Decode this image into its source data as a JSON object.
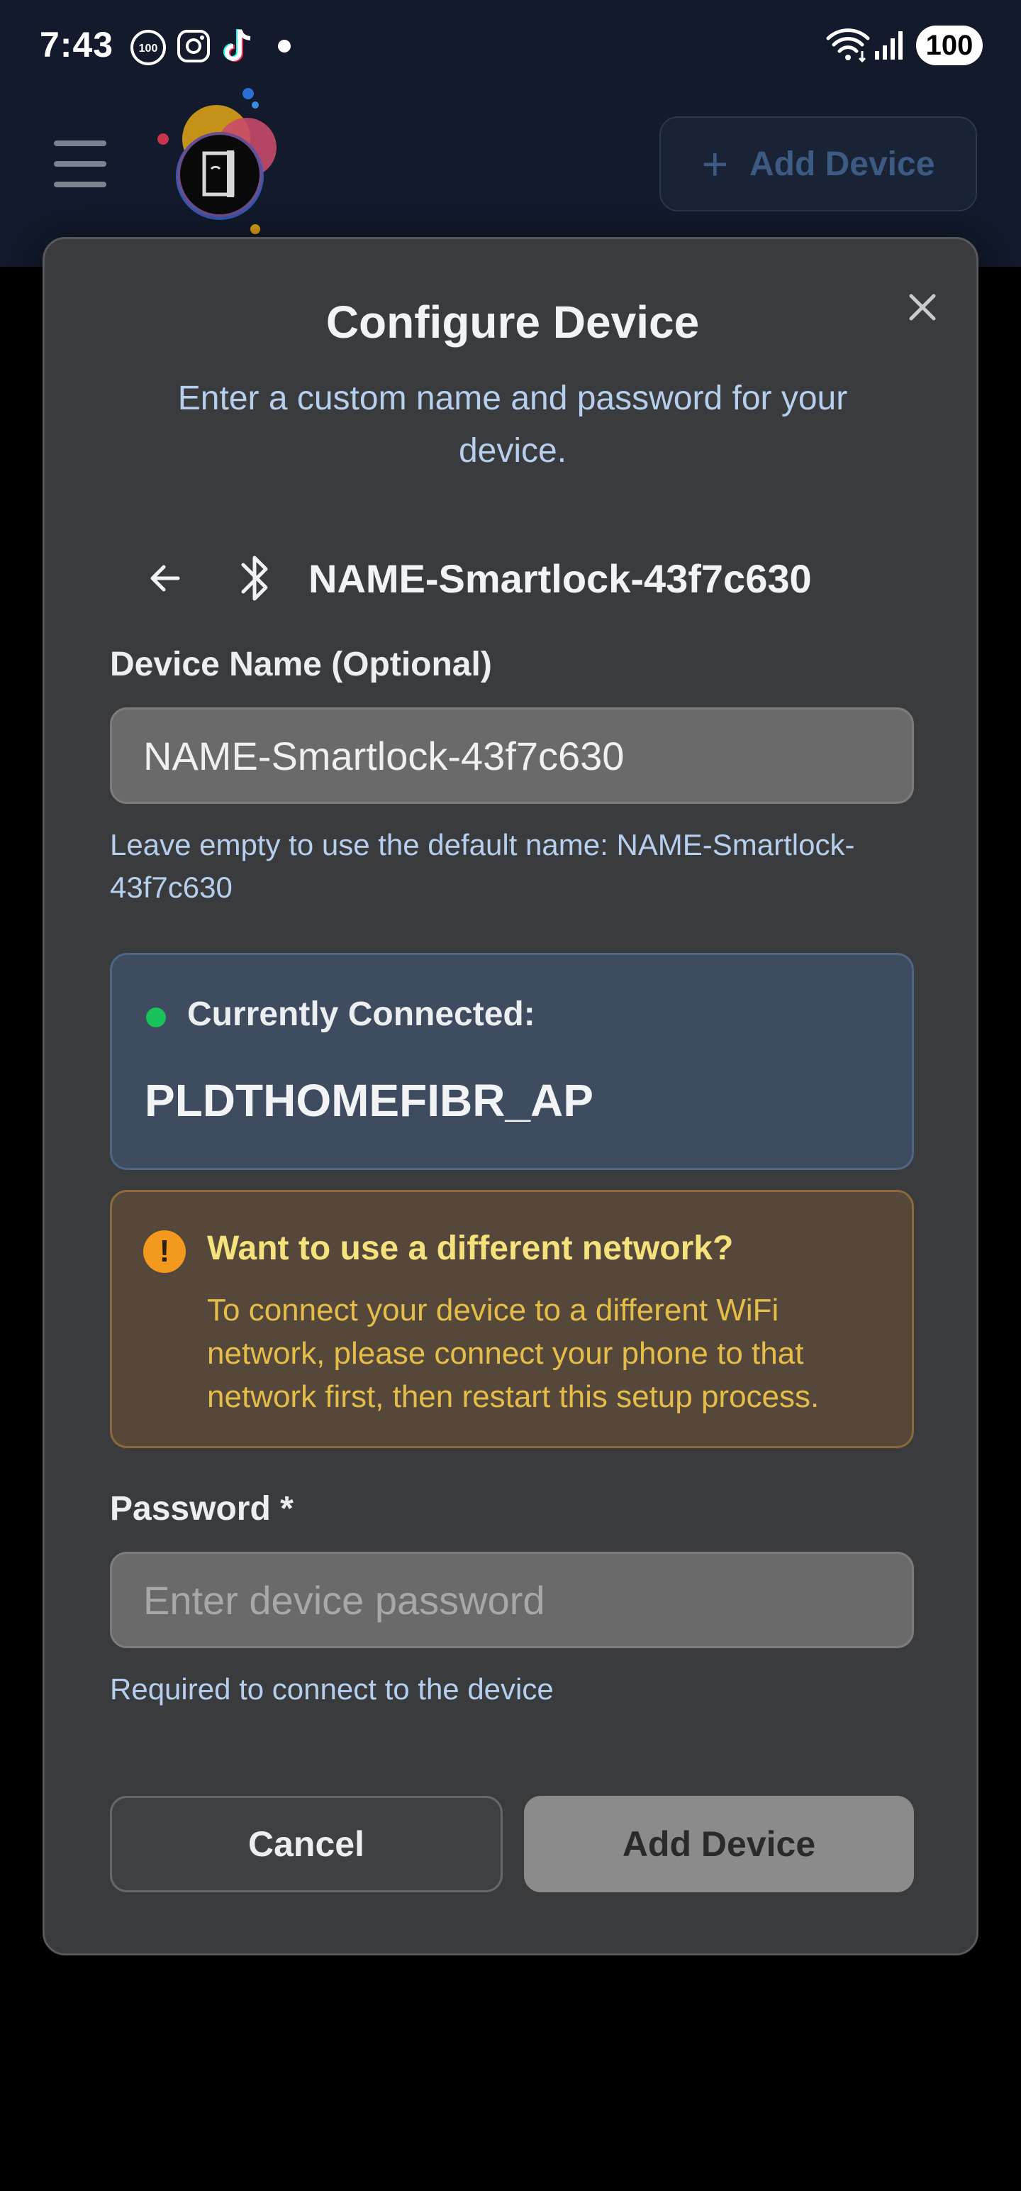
{
  "status_bar": {
    "time": "7:43",
    "notification_icons": [
      "100-badge-icon",
      "instagram-icon",
      "tiktok-icon",
      "dot-icon"
    ],
    "battery": "100"
  },
  "header": {
    "add_device_label": "Add Device"
  },
  "modal": {
    "title": "Configure Device",
    "subtitle": "Enter a custom name and password for your device.",
    "selected_device_name": "NAME-Smartlock-43f7c630",
    "device_name_label": "Device Name (Optional)",
    "device_name_value": "NAME-Smartlock-43f7c630",
    "device_name_helper": "Leave empty to use the default name: NAME-Smartlock-43f7c630",
    "connected": {
      "label": "Currently Connected:",
      "network": "PLDTHOMEFIBR_AP"
    },
    "warning": {
      "title": "Want to use a different network?",
      "body": "To connect your device to a different WiFi network, please connect your phone to that network first, then restart this setup process."
    },
    "password_label": "Password *",
    "password_placeholder": "Enter device password",
    "password_helper": "Required to connect to the device",
    "cancel_label": "Cancel",
    "add_label": "Add Device"
  },
  "colors": {
    "header_bg": "#121a2b",
    "modal_bg": "#3a3b3d",
    "accent_blue_text": "#b6cfee",
    "connected_dot": "#19c25a",
    "warning_icon": "#f39a1e",
    "warning_title": "#f6e27c",
    "warning_text": "#e5be4a"
  }
}
